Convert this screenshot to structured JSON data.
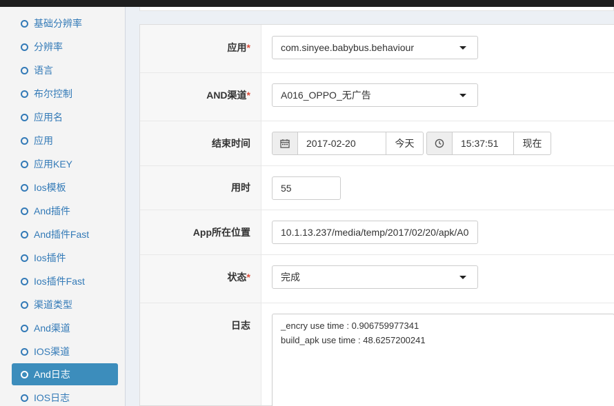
{
  "sidebar": {
    "items": [
      {
        "label": "基础分辨率"
      },
      {
        "label": "分辨率"
      },
      {
        "label": "语言"
      },
      {
        "label": "布尔控制"
      },
      {
        "label": "应用名"
      },
      {
        "label": "应用"
      },
      {
        "label": "应用KEY"
      },
      {
        "label": "Ios模板"
      },
      {
        "label": "And插件"
      },
      {
        "label": "And插件Fast"
      },
      {
        "label": "Ios插件"
      },
      {
        "label": "Ios插件Fast"
      },
      {
        "label": "渠道类型"
      },
      {
        "label": "And渠道"
      },
      {
        "label": "IOS渠道"
      },
      {
        "label": "And日志"
      },
      {
        "label": "IOS日志"
      }
    ],
    "active_index": 15
  },
  "form": {
    "app": {
      "label": "应用",
      "required": "*",
      "value": "com.sinyee.babybus.behaviour"
    },
    "channel": {
      "label": "AND渠道",
      "required": "*",
      "value": "A016_OPPO_无广告"
    },
    "end_time": {
      "label": "结束时间",
      "date": "2017-02-20",
      "today_button": "今天",
      "time": "15:37:51",
      "now_button": "现在"
    },
    "duration": {
      "label": "用时",
      "value": "55"
    },
    "app_path": {
      "label": "App所在位置",
      "value": "10.1.13.237/media/temp/2017/02/20/apk/A0"
    },
    "status": {
      "label": "状态",
      "required": "*",
      "value": "完成"
    },
    "log": {
      "label": "日志",
      "value": "_encry use time : 0.906759977341\nbuild_apk use time : 48.6257200241"
    }
  },
  "colors": {
    "accent": "#3c8dbc",
    "link": "#337ab7",
    "required": "#dd4b39"
  }
}
